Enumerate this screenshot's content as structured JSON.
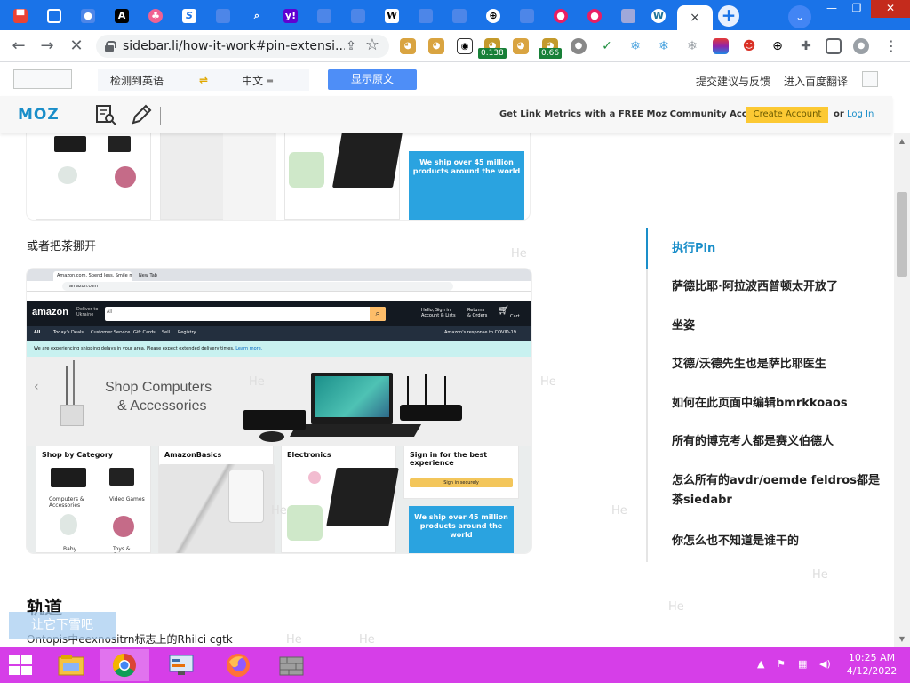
{
  "browser": {
    "tabs_count": 25,
    "active_tab_close": "×",
    "new_tab": "+",
    "tab_search": "⌄",
    "window_controls": {
      "minimize": "—",
      "restore": "❐",
      "close": "✕"
    },
    "url": "sidebar.li/how-it-work#pin-extensi...",
    "extension_badges": [
      "0.138",
      "0.66"
    ]
  },
  "translate_bar": {
    "detected": "检测到英语",
    "arrow": "⇌",
    "target_lang": "中文",
    "show_original": "显示原文",
    "feedback": "提交建议与反馈",
    "go_baidu": "进入百度翻译"
  },
  "mozbar": {
    "logo": "MOZ",
    "promo": "Get Link Metrics with a FREE Moz Community Account",
    "create_account": "Create Account",
    "or": "or",
    "log_in": "Log In"
  },
  "content": {
    "paragraph_1": "或者把茶挪开",
    "heading": "轨道",
    "paragraph_2": "Ontopis中eexnositrn标志上的Rhilci cgtk",
    "ghost_text": "He",
    "snack_text": "让它下雪吧"
  },
  "amazon_screenshot": {
    "tab1": "Amazon.com. Spend less. Smile more.",
    "tab2": "New Tab",
    "url": "amazon.com",
    "logo": "amazon",
    "deliver_to": "Deliver to\nUkraine",
    "search_scope": "All",
    "account_label": "Hello, Sign in\nAccount & Lists",
    "returns_label": "Returns\n& Orders",
    "cart_label": "Cart",
    "nav_items": [
      "All",
      "Today's Deals",
      "Customer Service",
      "Gift Cards",
      "Sell",
      "Registry"
    ],
    "covid_link": "Amazon's response to COVID-19",
    "notice": "We are experiencing shipping delays in your area. Please expect extended delivery times.",
    "notice_link": "Learn more.",
    "hero_text_1": "Shop Computers",
    "hero_text_2": "& Accessories",
    "cards": [
      {
        "title": "Shop by Category",
        "labels": [
          "Computers & Accessories",
          "Video Games",
          "Baby",
          "Toys & Games"
        ]
      },
      {
        "title": "AmazonBasics",
        "labels": []
      },
      {
        "title": "Electronics",
        "labels": []
      },
      {
        "title": "Sign in for the best experience",
        "labels": [],
        "button": "Sign in securely"
      }
    ],
    "promo_text": "We ship over 45 million products around the world"
  },
  "toc": {
    "items": [
      "执行Pin",
      "萨德比耶·阿拉波西普顿太开放了",
      "坐姿",
      "艾德/沃德先生也是萨比耶医生",
      "如何在此页面中编辑bmrkkoaos",
      "所有的博克考人都是赛义伯德人",
      "怎么所有的avdr/oemde feldros都是茶siedabr",
      "你怎么也不知道是谁干的"
    ]
  },
  "taskbar": {
    "time": "10:25 AM",
    "date": "4/12/2022"
  },
  "colors": {
    "chrome_blue": "#1a73e8",
    "moz_blue": "#1a8ec9",
    "moz_yellow": "#fcc933",
    "taskbar": "#d63ee8",
    "amazon_dark": "#232f3e",
    "amazon_orange": "#febd69"
  }
}
